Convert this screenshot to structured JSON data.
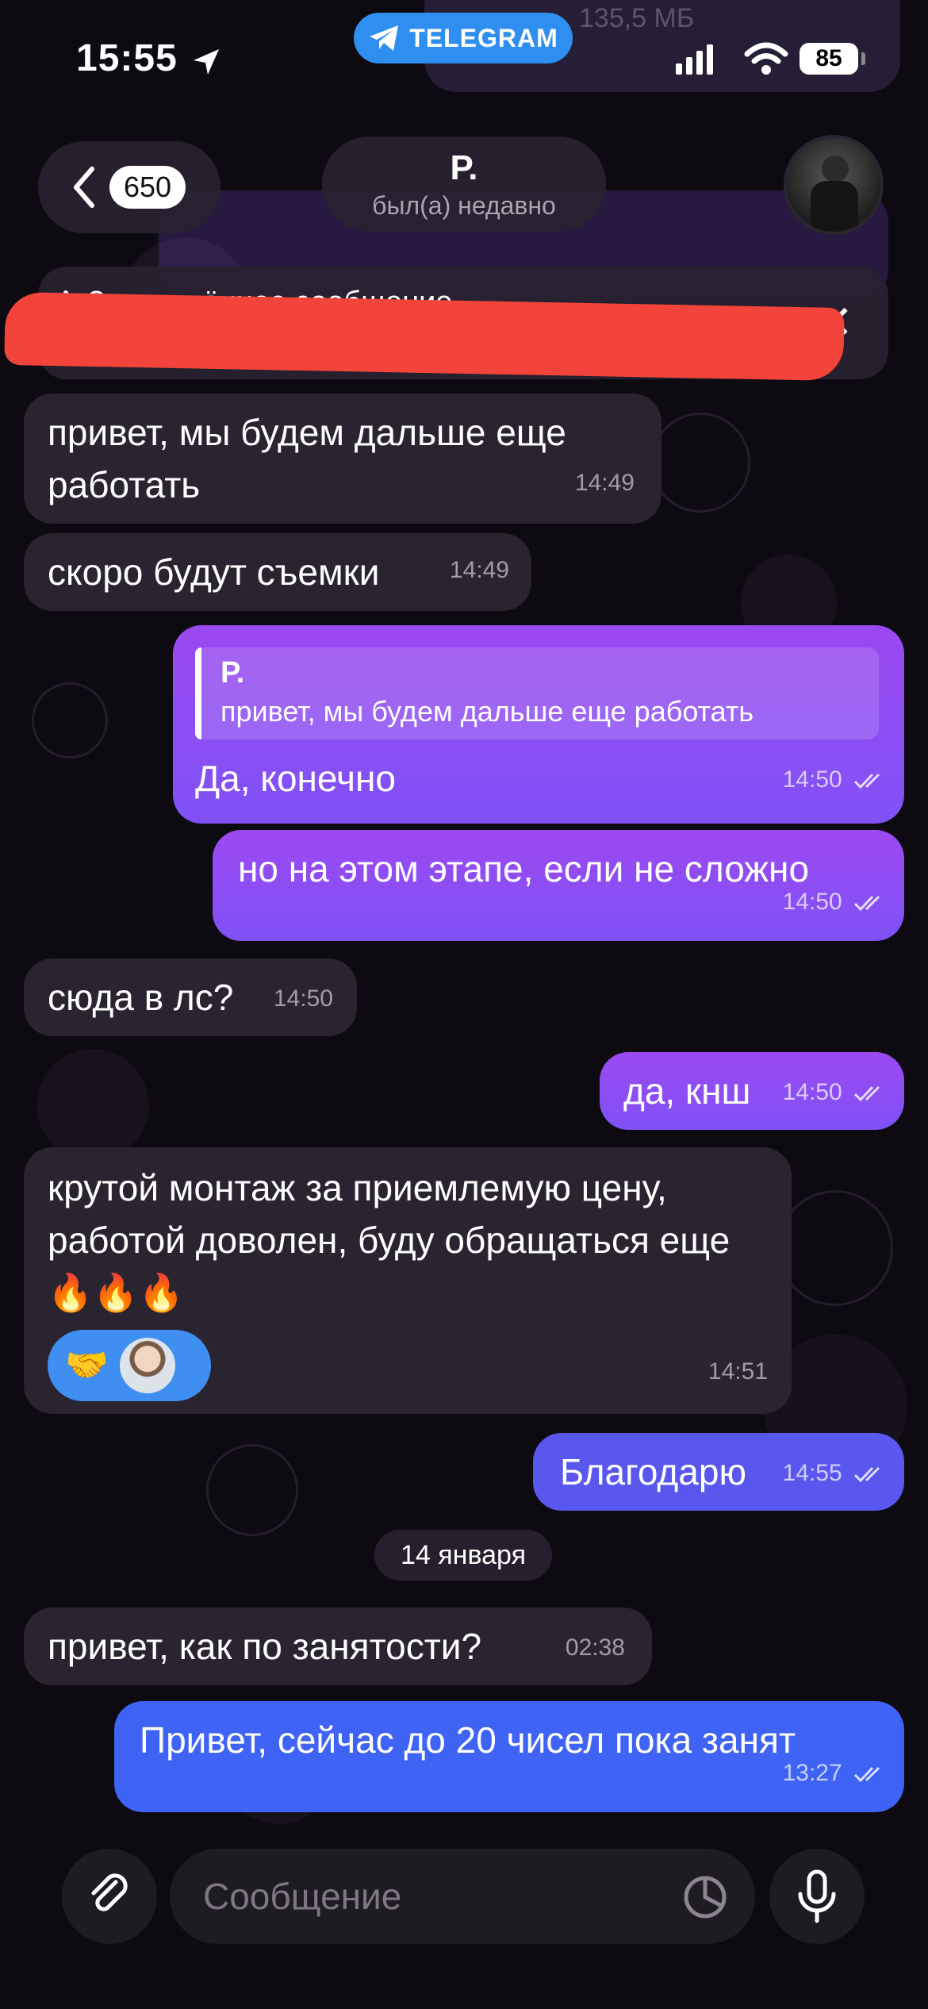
{
  "status_bar": {
    "time": "15:55",
    "app_pill": "TELEGRAM",
    "battery": "85"
  },
  "background_ghost": {
    "top_text": "135,5 МБ"
  },
  "header": {
    "back_count": "650",
    "contact_name": "Р.",
    "contact_status": "был(а) недавно"
  },
  "pinned": {
    "title": "Закреплённое сообщение",
    "text": ""
  },
  "messages": [
    {
      "dir": "in",
      "text": "привет, мы будем дальше еще работать",
      "time": "14:49"
    },
    {
      "dir": "in",
      "text": "скоро будут съемки",
      "time": "14:49"
    },
    {
      "dir": "out",
      "reply_name": "Р.",
      "reply_text": "привет, мы будем дальше еще работать",
      "text": "Да, конечно",
      "time": "14:50"
    },
    {
      "dir": "out",
      "text": "но на этом этапе, если не сложно",
      "time": "14:50"
    },
    {
      "dir": "in",
      "text": "сюда в лс?",
      "time": "14:50"
    },
    {
      "dir": "out",
      "text": "да, кнш",
      "time": "14:50"
    },
    {
      "dir": "in",
      "text": "крутой монтаж за приемлемую цену, работой доволен, буду обращаться еще🔥🔥🔥",
      "time": "14:51",
      "reaction_emoji": "🤝"
    },
    {
      "dir": "out",
      "text": "Благодарю",
      "time": "14:55"
    },
    {
      "dir": "in",
      "text": "привет, как по занятости?",
      "time": "02:38"
    },
    {
      "dir": "out",
      "text": "Привет, сейчас до 20 чисел пока занят",
      "time": "13:27"
    }
  ],
  "date_separator": "14 января",
  "composer": {
    "placeholder": "Сообщение"
  },
  "colors": {
    "incoming_bubble": "#2a2431",
    "outgoing_purple": "#8f4cf2",
    "outgoing_blue": "#3e63f5",
    "accent": "#2f8ff0",
    "redaction": "#f2443a"
  }
}
